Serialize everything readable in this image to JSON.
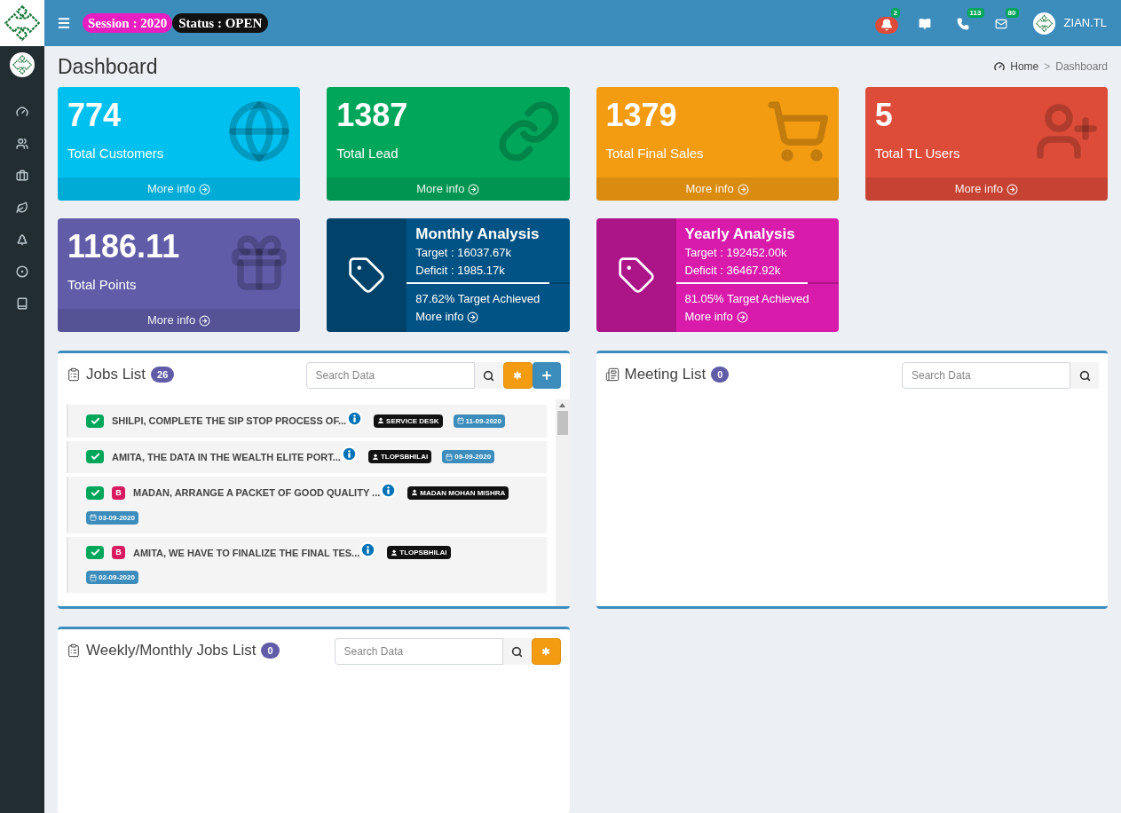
{
  "header": {
    "session": "Session : 2020",
    "status": "Status : OPEN",
    "notifications": [
      {
        "kind": "bell",
        "count": "2"
      },
      {
        "kind": "book"
      },
      {
        "kind": "phone",
        "count": "113"
      },
      {
        "kind": "mail",
        "count": "80"
      }
    ],
    "user": "ZIAN.TL"
  },
  "sidebar": {
    "items": [
      {
        "kind": "gauge"
      },
      {
        "kind": "users"
      },
      {
        "kind": "briefcase"
      },
      {
        "kind": "leaf"
      },
      {
        "kind": "tree"
      },
      {
        "kind": "circle"
      },
      {
        "kind": "book"
      }
    ]
  },
  "page": {
    "title": "Dashboard",
    "breadcrumb": [
      "Home",
      "Dashboard"
    ],
    "separator": ">"
  },
  "stats": [
    {
      "value": "774",
      "label": "Total Customers",
      "link": "More info",
      "color": "#00c0ef",
      "kind": "globe"
    },
    {
      "value": "1387",
      "label": "Total Lead",
      "link": "More info",
      "color": "#00a65a",
      "kind": "link"
    },
    {
      "value": "1379",
      "label": "Total Final Sales",
      "link": "More info",
      "color": "#f39c12",
      "kind": "cart"
    },
    {
      "value": "5",
      "label": "Total TL Users",
      "link": "More info",
      "color": "#dd4b39",
      "kind": "user"
    },
    {
      "value": "1186.11",
      "label": "Total Points",
      "link": "More info",
      "color": "#605ca8",
      "kind": "gift"
    }
  ],
  "analysis": [
    {
      "title": "Monthly Analysis",
      "target": "Target : 16037.67k",
      "deficit": "Deficit : 1985.17k",
      "level": 0.8762,
      "achieved": "87.62% Target Achieved",
      "link": "More info",
      "color": "#005384"
    },
    {
      "title": "Yearly Analysis",
      "target": "Target : 192452.00k",
      "deficit": "Deficit : 36467.92k",
      "level": 0.8105,
      "achieved": "81.05% Target Achieved",
      "link": "More info",
      "color": "#d81bab"
    }
  ],
  "jobs": {
    "title": "Jobs List",
    "count": "26",
    "search_placeholder": "Search Data",
    "rows": [
      {
        "checked": true,
        "title": "SHILPI, COMPLETE THE SIP STOP PROCESS OF...",
        "assignee": "SERVICE DESK",
        "date": "11-09-2020"
      },
      {
        "checked": true,
        "title": "AMITA, THE DATA IN THE WEALTH ELITE PORT...",
        "assignee": "TLOPSBHILAI",
        "date": "09-09-2020"
      },
      {
        "checked": true,
        "priority": "B",
        "title": "MADAN, ARRANGE A PACKET OF GOOD QUALITY ...",
        "assignee": "MADAN MOHAN MISHRA",
        "date": "03-09-2020"
      },
      {
        "checked": true,
        "priority": "B",
        "title": "AMITA, WE HAVE TO FINALIZE THE FINAL TES...",
        "assignee": "TLOPSBHILAI",
        "date": "02-09-2020"
      }
    ]
  },
  "meetings": {
    "title": "Meeting List",
    "count": "0",
    "search_placeholder": "Search Data"
  },
  "weekly": {
    "title": "Weekly/Monthly Jobs List",
    "count": "0",
    "search_placeholder": "Search Data"
  }
}
